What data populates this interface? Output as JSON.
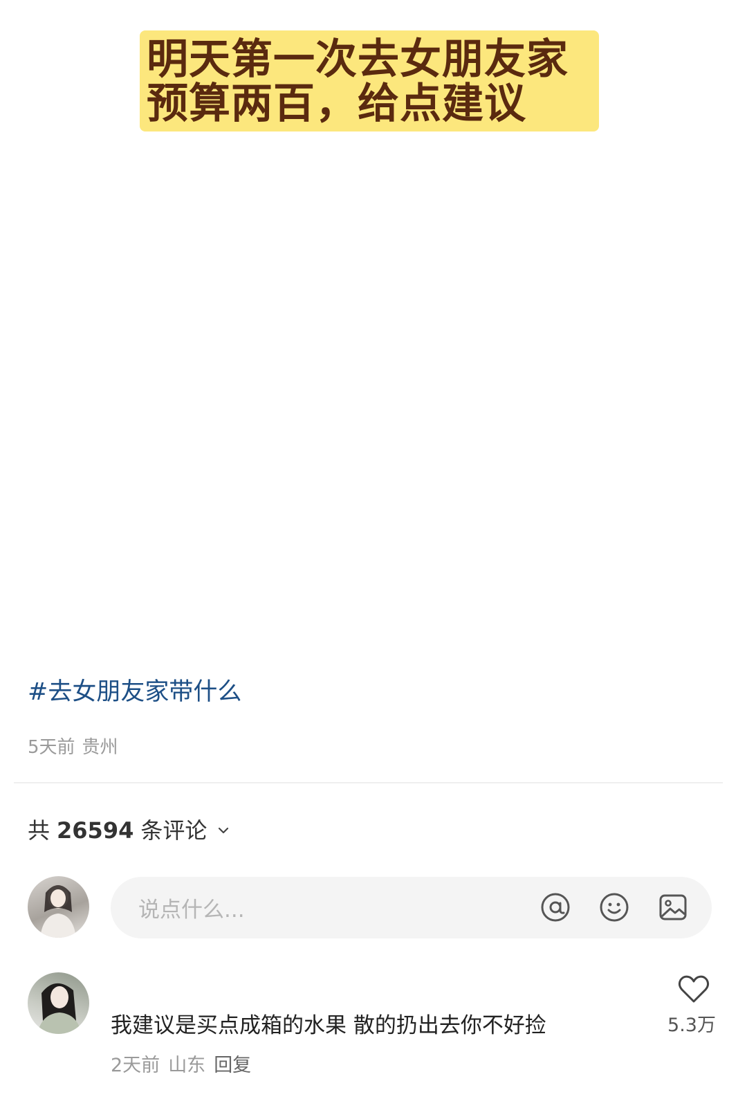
{
  "post": {
    "banner_line1": "明天第一次去女朋友家",
    "banner_line2": "预算两百，给点建议",
    "hashtag": "#去女朋友家带什么",
    "time": "5天前",
    "location": "贵州"
  },
  "comments_header": {
    "prefix": "共",
    "count": "26594",
    "suffix": "条评论"
  },
  "comment_input": {
    "placeholder": "说点什么..."
  },
  "comments": [
    {
      "text": "我建议是买点成箱的水果 散的扔出去你不好捡",
      "time": "2天前",
      "location": "山东",
      "reply_label": "回复",
      "likes": "5.3万"
    }
  ],
  "colors": {
    "banner_bg": "#fce77d",
    "banner_text": "#5a2a0f",
    "hashtag": "#1d4f86",
    "meta": "#9a9a9a"
  },
  "icons": [
    "chevron-down-icon",
    "at-icon",
    "emoji-icon",
    "image-icon",
    "heart-icon"
  ]
}
